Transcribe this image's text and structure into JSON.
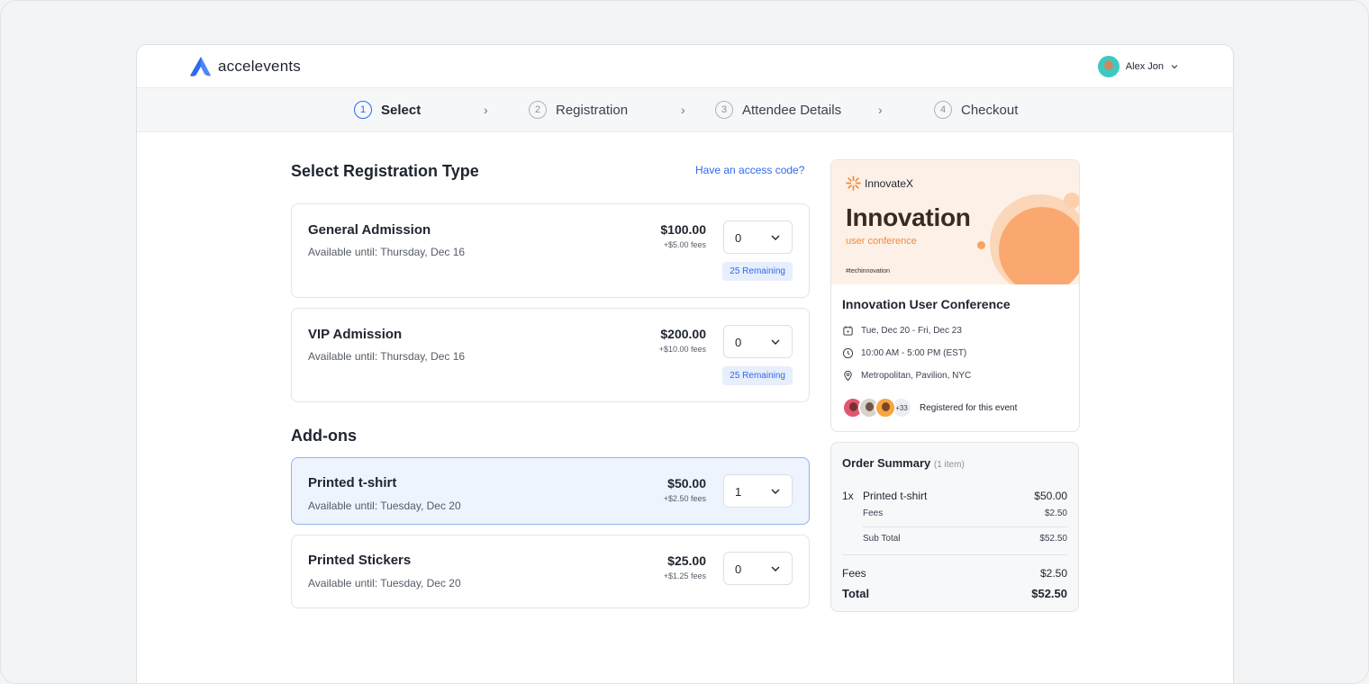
{
  "app": {
    "name": "accelevents",
    "user_name": "Alex Jon"
  },
  "steps": [
    {
      "num": "1",
      "label": "Select",
      "active": true
    },
    {
      "num": "2",
      "label": "Registration",
      "active": false
    },
    {
      "num": "3",
      "label": "Attendee Details",
      "active": false
    },
    {
      "num": "4",
      "label": "Checkout",
      "active": false
    }
  ],
  "registration": {
    "title": "Select Registration Type",
    "access_code_link": "Have an access code?",
    "tickets": [
      {
        "name": "General Admission",
        "available": "Available until: Thursday, Dec 16",
        "price": "$100.00",
        "fee": "+$5.00 fees",
        "qty": "0",
        "remaining": "25 Remaining"
      },
      {
        "name": "VIP Admission",
        "available": "Available until: Thursday, Dec 16",
        "price": "$200.00",
        "fee": "+$10.00 fees",
        "qty": "0",
        "remaining": "25 Remaining"
      }
    ]
  },
  "addons": {
    "title": "Add-ons",
    "items": [
      {
        "name": "Printed t-shirt",
        "available": "Available until: Tuesday, Dec 20",
        "price": "$50.00",
        "fee": "+$2.50 fees",
        "qty": "1",
        "selected": true
      },
      {
        "name": "Printed Stickers",
        "available": "Available until: Tuesday, Dec 20",
        "price": "$25.00",
        "fee": "+$1.25 fees",
        "qty": "0",
        "selected": false
      }
    ]
  },
  "event": {
    "brand": "InnovateX",
    "banner_title": "Innovation",
    "banner_subtitle": "user conference",
    "banner_tag": "#techinnovation",
    "name": "Innovation User Conference",
    "dates": "Tue, Dec 20 - Fri, Dec 23",
    "time": "10:00 AM - 5:00 PM (EST)",
    "location": "Metropolitan, Pavilion, NYC",
    "attendee_more": "+33",
    "attendee_label": "Registered for this event"
  },
  "summary": {
    "title": "Order Summary",
    "count": "(1 item)",
    "item_qty": "1x",
    "item_name": "Printed t-shirt",
    "item_price": "$50.00",
    "item_fees_label": "Fees",
    "item_fees": "$2.50",
    "subtotal_label": "Sub Total",
    "subtotal": "$52.50",
    "fees_label": "Fees",
    "fees": "$2.50",
    "total_label": "Total",
    "total": "$52.50"
  },
  "colors": {
    "accent": "#2d6bf0",
    "banner_orange": "#f9a062",
    "selected_bg": "#eef4fd"
  }
}
